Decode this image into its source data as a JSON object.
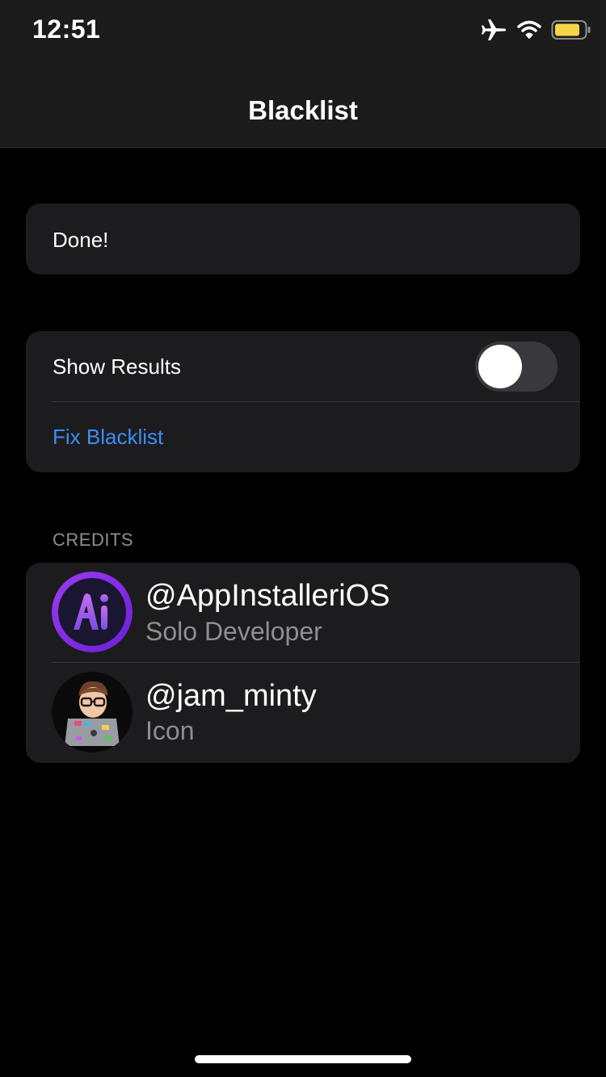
{
  "status_bar": {
    "time": "12:51",
    "icons": [
      "airplane-icon",
      "wifi-icon",
      "battery-icon"
    ],
    "battery_color": "#f5d547"
  },
  "nav": {
    "title": "Blacklist"
  },
  "status_card": {
    "message": "Done!"
  },
  "actions": {
    "show_results_label": "Show Results",
    "show_results_on": false,
    "fix_label": "Fix Blacklist",
    "link_color": "#3a8ef6"
  },
  "credits": {
    "header": "CREDITS",
    "items": [
      {
        "name": "@AppInstalleriOS",
        "role": "Solo Developer",
        "avatar": "appinstaller-logo"
      },
      {
        "name": "@jam_minty",
        "role": "Icon",
        "avatar": "memoji-avatar"
      }
    ]
  }
}
